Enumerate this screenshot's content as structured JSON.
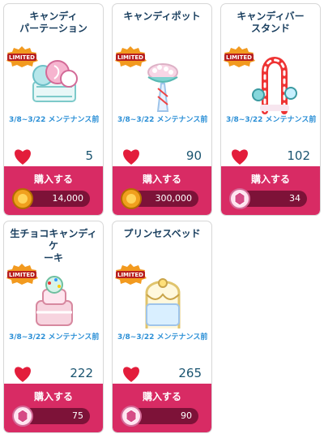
{
  "ui": {
    "buy_label": "購入する",
    "maintenance": "3/8~3/22 メンテナンス前",
    "limited_badge": "LIMITED"
  },
  "items": [
    {
      "name": "キャンディ\nパーテーション",
      "likes": "5",
      "price": "14,000",
      "currency": "coin"
    },
    {
      "name": "キャンディポット",
      "likes": "90",
      "price": "300,000",
      "currency": "coin"
    },
    {
      "name": "キャンディバー\nスタンド",
      "likes": "102",
      "price": "34",
      "currency": "gem"
    },
    {
      "name": "生チョコキャンディケ\nーキ",
      "likes": "222",
      "price": "75",
      "currency": "gem"
    },
    {
      "name": "プリンセスベッド",
      "likes": "265",
      "price": "90",
      "currency": "gem"
    }
  ],
  "colors": {
    "buy_background": "#d82b64",
    "price_bar": "#7d1238",
    "title_text": "#1a3f5f",
    "maintenance_text": "#2b8fd6"
  },
  "icons": [
    "limited-badge-icon",
    "heart-icon",
    "coin-icon",
    "gem-icon"
  ]
}
